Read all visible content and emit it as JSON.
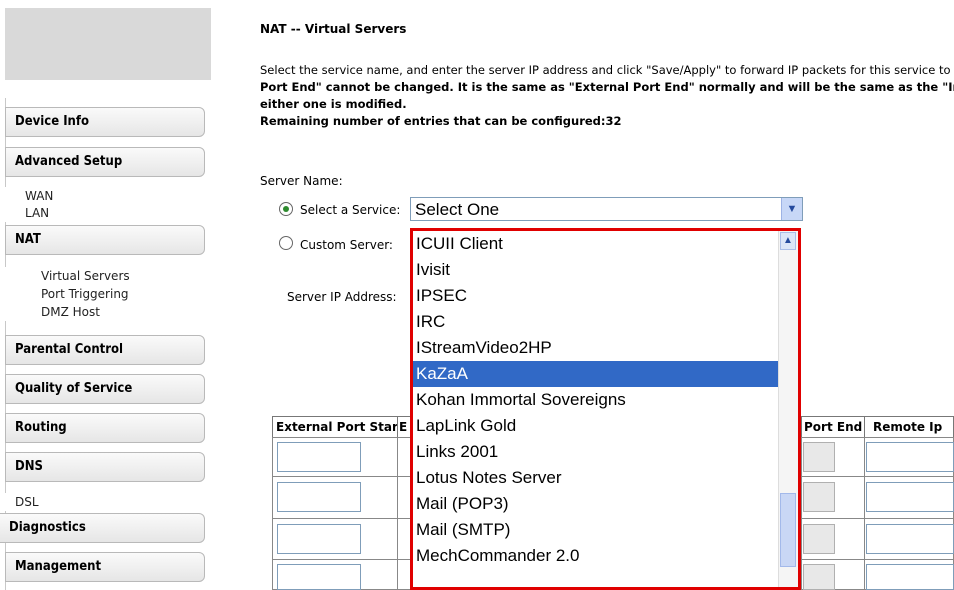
{
  "sidebar": {
    "items": [
      {
        "label": "Device Info"
      },
      {
        "label": "Advanced Setup"
      },
      {
        "label": "WAN"
      },
      {
        "label": "LAN"
      },
      {
        "label": "NAT"
      },
      {
        "label": "Virtual Servers"
      },
      {
        "label": "Port Triggering"
      },
      {
        "label": "DMZ Host"
      },
      {
        "label": "Parental Control"
      },
      {
        "label": "Quality of Service"
      },
      {
        "label": "Routing"
      },
      {
        "label": "DNS"
      },
      {
        "label": "DSL"
      },
      {
        "label": "Diagnostics"
      },
      {
        "label": "Management"
      }
    ]
  },
  "page": {
    "title": "NAT -- Virtual Servers",
    "desc_line1": "Select the service name, and enter the server IP address and click \"Save/Apply\" to forward IP packets for this service to",
    "desc_line2": "Port End\" cannot be changed. It is the same as \"External Port End\" normally and will be the same as the \"Int",
    "desc_line3": "either one is modified.",
    "desc_line4": "Remaining number of entries that can be configured:32"
  },
  "form": {
    "server_name_label": "Server Name:",
    "select_service_label": "Select a Service:",
    "custom_server_label": "Custom Server:",
    "server_ip_label": "Server IP Address:",
    "selected_service": "Select One"
  },
  "dropdown": {
    "options": [
      "ICUII Client",
      "Ivisit",
      "IPSEC",
      "IRC",
      "IStreamVideo2HP",
      "KaZaA",
      "Kohan Immortal Sovereigns",
      "LapLink Gold",
      "Links 2001",
      "Lotus Notes Server",
      "Mail (POP3)",
      "Mail (SMTP)",
      "MechCommander 2.0"
    ],
    "highlighted": "KaZaA"
  },
  "table": {
    "headers": [
      "External Port Start",
      "E",
      "Port End",
      "Remote Ip"
    ]
  },
  "colors": {
    "highlight": "#3169c6",
    "dropdown_border": "#e00000",
    "radio_checked": "#2e8b2e"
  }
}
